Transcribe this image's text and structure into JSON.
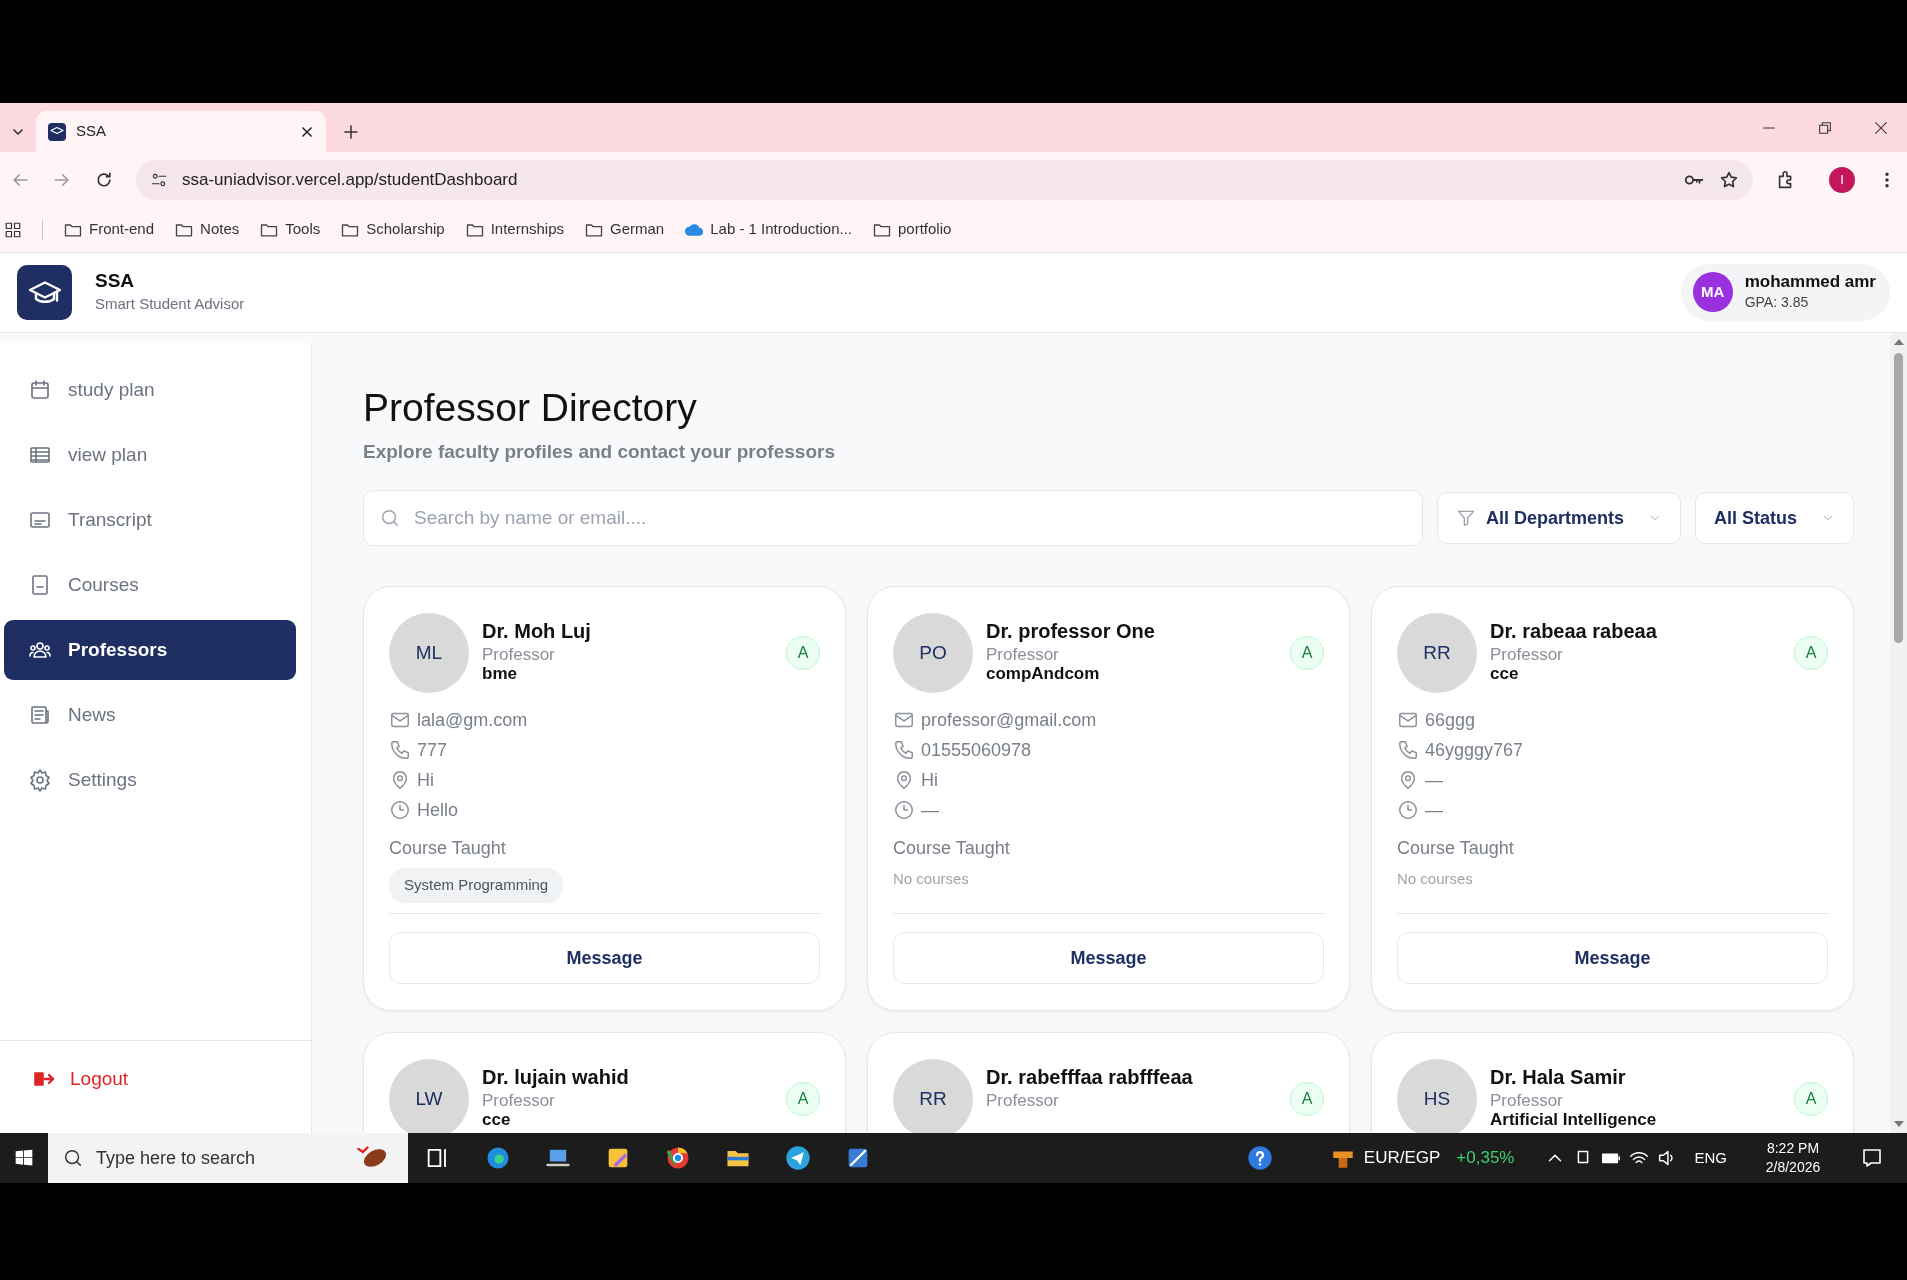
{
  "browser": {
    "tabs": [
      {
        "title": "SSA",
        "selected": true
      }
    ],
    "url": "ssa-uniadvisor.vercel.app/studentDashboard",
    "profile_initial": "I",
    "bookmarks": [
      {
        "label": "Front-end",
        "kind": "folder"
      },
      {
        "label": "Notes",
        "kind": "folder"
      },
      {
        "label": "Tools",
        "kind": "folder"
      },
      {
        "label": "Scholarship",
        "kind": "folder"
      },
      {
        "label": "Internships",
        "kind": "folder"
      },
      {
        "label": "German",
        "kind": "folder"
      },
      {
        "label": "Lab - 1 Introduction...",
        "kind": "site"
      },
      {
        "label": "portfolio",
        "kind": "folder"
      }
    ]
  },
  "app": {
    "logo_title": "SSA",
    "logo_subtitle": "Smart Student Advisor",
    "user": {
      "initials": "MA",
      "name": "mohammed amr",
      "gpa": "GPA: 3.85"
    }
  },
  "sidebar": {
    "items": [
      {
        "label": "study plan",
        "selected": false
      },
      {
        "label": "view plan",
        "selected": false
      },
      {
        "label": "Transcript",
        "selected": false
      },
      {
        "label": "Courses",
        "selected": false
      },
      {
        "label": "Professors",
        "selected": true
      },
      {
        "label": "News",
        "selected": false
      },
      {
        "label": "Settings",
        "selected": false
      }
    ],
    "logout": "Logout"
  },
  "directory": {
    "title": "Professor Directory",
    "subtitle": "Explore faculty profiles and contact your professors",
    "search_placeholder": "Search by name or email....",
    "filters": [
      {
        "label": "All Departments",
        "kind": "funnel"
      },
      {
        "label": "All Status",
        "kind": "plain"
      }
    ],
    "professors": [
      {
        "initials": "ML",
        "name": "Dr. Moh Luj",
        "title": "Professor",
        "department": "bme",
        "status": "A",
        "contacts": [
          {
            "kind": "email",
            "text": "lala@gm.com"
          },
          {
            "kind": "phone",
            "text": "777"
          },
          {
            "kind": "location",
            "text": "Hi"
          },
          {
            "kind": "hours",
            "text": "Hello"
          }
        ],
        "course_label": "Course Taught",
        "courses": [
          "System Programming"
        ],
        "button": "Message"
      },
      {
        "initials": "PO",
        "name": "Dr. professor One",
        "title": "Professor",
        "department": "compAndcom",
        "status": "A",
        "contacts": [
          {
            "kind": "email",
            "text": "professor@gmail.com"
          },
          {
            "kind": "phone",
            "text": "01555060978"
          },
          {
            "kind": "location",
            "text": "Hi"
          },
          {
            "kind": "hours",
            "text": "—"
          }
        ],
        "course_label": "Course Taught",
        "no_courses": "No courses",
        "button": "Message"
      },
      {
        "initials": "RR",
        "name": "Dr. rabeaa rabeaa",
        "title": "Professor",
        "department": "cce",
        "status": "A",
        "contacts": [
          {
            "kind": "email",
            "text": "66ggg"
          },
          {
            "kind": "phone",
            "text": "46ygggy767"
          },
          {
            "kind": "location",
            "text": "—"
          },
          {
            "kind": "hours",
            "text": "—"
          }
        ],
        "course_label": "Course Taught",
        "no_courses": "No courses",
        "button": "Message"
      },
      {
        "initials": "LW",
        "name": "Dr. lujain wahid",
        "title": "Professor",
        "department": "cce",
        "status": "A"
      },
      {
        "initials": "RR",
        "name": "Dr. rabefffaa rabfffeaa",
        "title": "Professor",
        "status": "A"
      },
      {
        "initials": "HS",
        "name": "Dr. Hala Samir",
        "title": "Professor",
        "department": "Artificial Intelligence",
        "status": "A"
      }
    ]
  },
  "taskbar": {
    "search_placeholder": "Type here to search",
    "ticker": {
      "pair": "EUR/EGP",
      "change": "+0,35%"
    },
    "language": "ENG",
    "time": "8:22 PM",
    "date": "2/8/2026"
  }
}
